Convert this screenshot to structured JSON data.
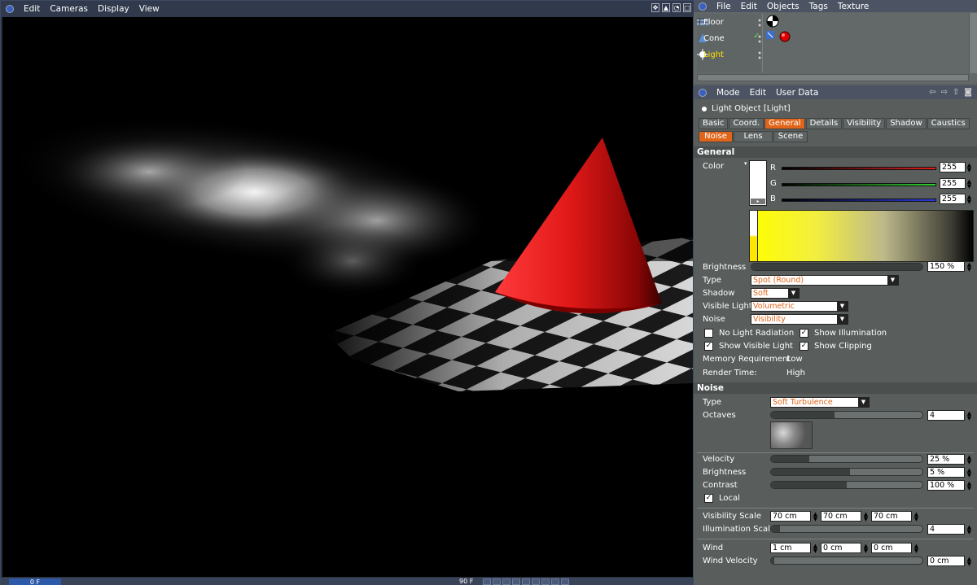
{
  "viewport": {
    "menu": [
      "Edit",
      "Cameras",
      "Display",
      "View"
    ],
    "current_frame": "0 F",
    "end_frame": "90 F"
  },
  "object_manager": {
    "menu": [
      "File",
      "Edit",
      "Objects",
      "Tags",
      "Texture"
    ],
    "objects": [
      {
        "name": "Floor",
        "icon": "floor-icon"
      },
      {
        "name": "Cone",
        "icon": "cone-icon"
      },
      {
        "name": "Light",
        "icon": "light-icon",
        "selected": true
      }
    ]
  },
  "attributes": {
    "menu": [
      "Mode",
      "Edit",
      "User Data"
    ],
    "object_title": "Light Object [Light]",
    "tabs_row1": [
      "Basic",
      "Coord.",
      "General",
      "Details",
      "Visibility",
      "Shadow",
      "Caustics"
    ],
    "tabs_row2": [
      "Noise",
      "Lens",
      "Scene"
    ],
    "active_tabs": [
      "General",
      "Noise"
    ],
    "general": {
      "section": "General",
      "color_label": "Color",
      "r_label": "R",
      "g_label": "G",
      "b_label": "B",
      "r": "255",
      "g": "255",
      "b": "255",
      "brightness_label": "Brightness",
      "brightness": "150 %",
      "brightness_level": 1.0,
      "type_label": "Type",
      "type": "Spot (Round)",
      "shadow_label": "Shadow",
      "shadow": "Soft",
      "visible_light_label": "Visible Light",
      "visible_light": "Volumetric",
      "noise_label": "Noise",
      "noise": "Visibility",
      "no_light_radiation": "No Light Radiation",
      "show_illumination": "Show Illumination",
      "show_visible_light": "Show Visible Light",
      "show_clipping": "Show Clipping",
      "memory_label": "Memory Requirement",
      "memory": "Low",
      "render_time_label": "Render Time:",
      "render_time": "High"
    },
    "noise": {
      "section": "Noise",
      "type_label": "Type",
      "type": "Soft Turbulence",
      "octaves_label": "Octaves",
      "octaves": "4",
      "octaves_level": 0.42,
      "velocity_label": "Velocity",
      "velocity": "25 %",
      "velocity_level": 0.25,
      "brightness_label": "Brightness",
      "brightness": "5 %",
      "brightness_level": 0.52,
      "contrast_label": "Contrast",
      "contrast": "100 %",
      "contrast_level": 0.5,
      "local_label": "Local",
      "visibility_scale_label": "Visibility Scale",
      "visibility_scale": [
        "70 cm",
        "70 cm",
        "70 cm"
      ],
      "illumination_scale_label": "Illumination Scale",
      "illumination_scale": "4",
      "wind_label": "Wind",
      "wind": [
        "1 cm",
        "0 cm",
        "0 cm"
      ],
      "wind_velocity_label": "Wind Velocity",
      "wind_velocity": "0 cm"
    }
  },
  "colors": {
    "accent": "#e0651a",
    "selected_object": "#ffe000",
    "cone": "#d81e1e"
  }
}
